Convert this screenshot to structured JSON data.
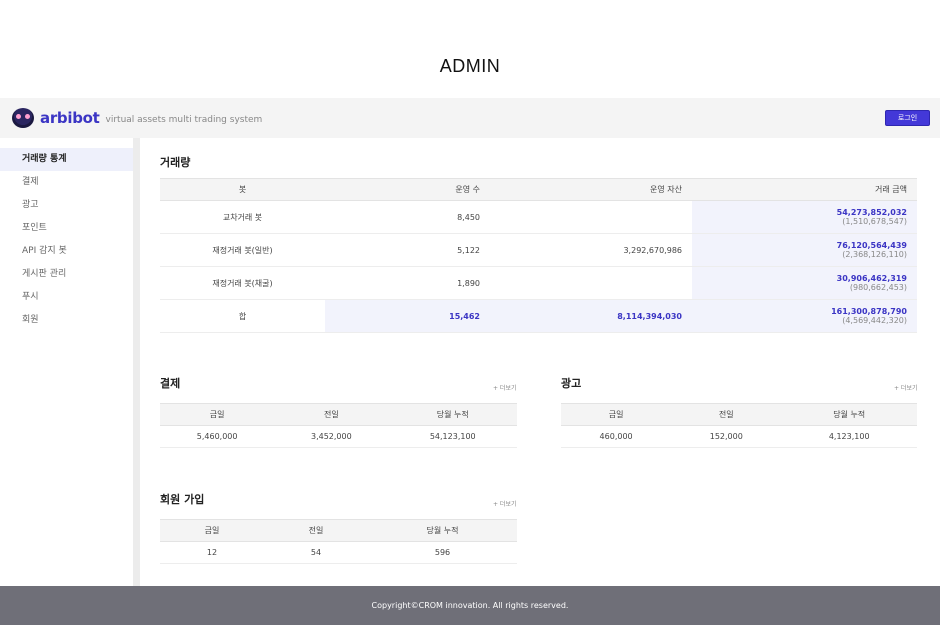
{
  "page": {
    "title": "ADMIN"
  },
  "header": {
    "logo_text": "arbibot",
    "tagline": "virtual assets multi trading system",
    "login_label": "로그인",
    "accent_color": "#4338d8"
  },
  "sidebar": {
    "items": [
      {
        "label": "거래량 통계",
        "active": true
      },
      {
        "label": "결제"
      },
      {
        "label": "광고"
      },
      {
        "label": "포인트"
      },
      {
        "label": "API 감지 봇"
      },
      {
        "label": "게시판 관리"
      },
      {
        "label": "푸시"
      },
      {
        "label": "회원"
      }
    ]
  },
  "volume": {
    "title": "거래량",
    "headers": [
      "봇",
      "운영 수",
      "운영 자산",
      "거래 금액"
    ],
    "rows": [
      {
        "bot": "교차거래 봇",
        "count": "8,450",
        "assets": "",
        "amount": "54,273,852,032",
        "amount_sub": "(1,510,678,547)"
      },
      {
        "bot": "재정거래 봇(일반)",
        "count": "5,122",
        "assets": "3,292,670,986",
        "amount": "76,120,564,439",
        "amount_sub": "(2,368,126,110)"
      },
      {
        "bot": "재정거래 봇(채굴)",
        "count": "1,890",
        "assets": "",
        "amount": "30,906,462,319",
        "amount_sub": "(980,662,453)"
      }
    ],
    "total": {
      "label": "합",
      "count": "15,462",
      "assets": "8,114,394,030",
      "amount": "161,300,878,790",
      "amount_sub": "(4,569,442,320)"
    }
  },
  "payment": {
    "title": "결제",
    "more": "+ 더보기",
    "headers": [
      "금일",
      "전일",
      "당월 누적"
    ],
    "values": [
      "5,460,000",
      "3,452,000",
      "54,123,100"
    ]
  },
  "ads": {
    "title": "광고",
    "more": "+ 더보기",
    "headers": [
      "금일",
      "전일",
      "당월 누적"
    ],
    "values": [
      "460,000",
      "152,000",
      "4,123,100"
    ]
  },
  "signup": {
    "title": "회원 가입",
    "more": "+ 더보기",
    "headers": [
      "금일",
      "전일",
      "당월 누적"
    ],
    "values": [
      "12",
      "54",
      "596"
    ]
  },
  "footer": {
    "text": "Copyright©CROM innovation. All rights reserved."
  }
}
